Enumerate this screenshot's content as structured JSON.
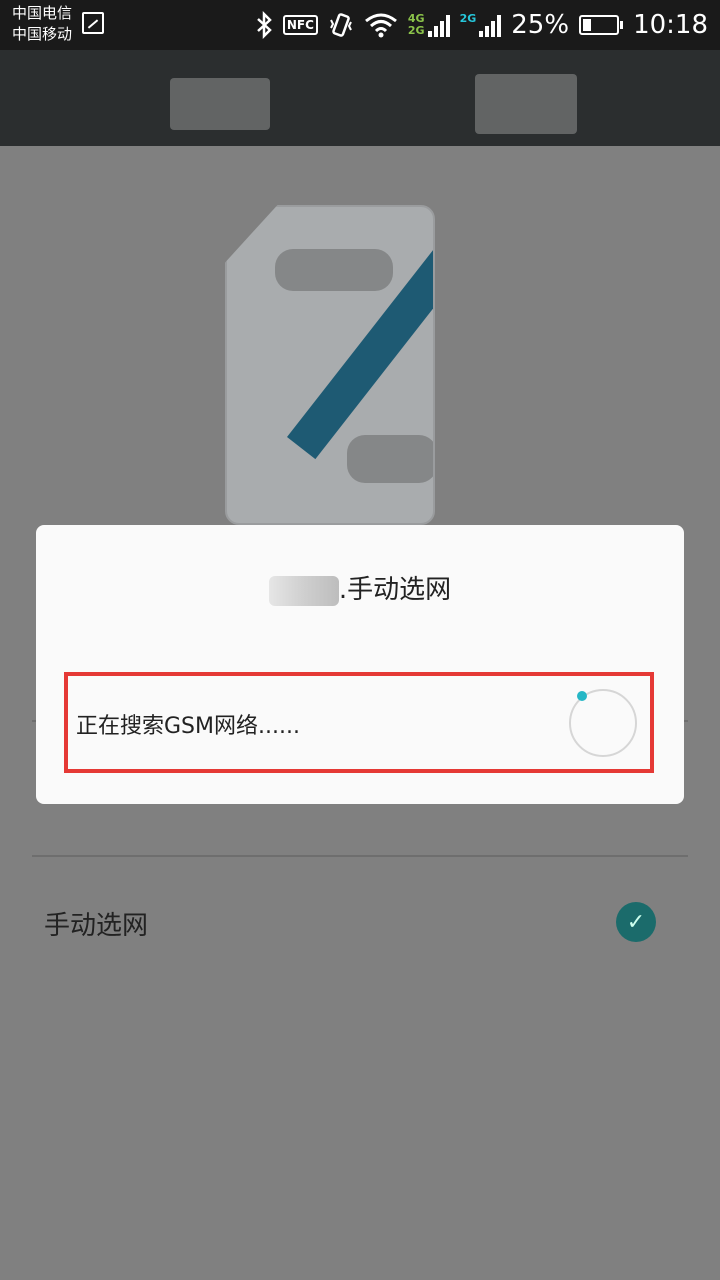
{
  "status_bar": {
    "carrier_1": "中国电信",
    "carrier_2": "中国移动",
    "nfc_label": "NFC",
    "net_4g": "4G",
    "net_2g_a": "2G",
    "net_2g_b": "2G",
    "battery_percent": "25%",
    "battery_level": 0.25,
    "time": "10:18",
    "icons": [
      "gallery-icon",
      "bluetooth-icon",
      "nfc-icon",
      "vibrate-icon",
      "wifi-icon",
      "signal-icon",
      "signal-icon",
      "battery-icon"
    ]
  },
  "page": {
    "option_manual_label": "手动选网",
    "option_manual_checked": true
  },
  "dialog": {
    "title_suffix": ".手动选网",
    "progress_message": "正在搜索GSM网络......",
    "accent_color": "#26b7c6"
  },
  "colors": {
    "highlight_border": "#e53935",
    "check_bg": "#1b6b6b"
  }
}
